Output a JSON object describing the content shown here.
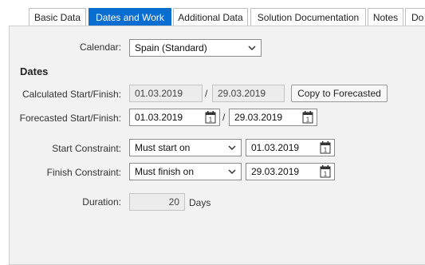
{
  "tabs": [
    {
      "label": "Basic Data",
      "active": false
    },
    {
      "label": "Dates and Work",
      "active": true
    },
    {
      "label": "Additional Data",
      "active": false
    },
    {
      "label": "Solution Documentation",
      "active": false
    },
    {
      "label": "Notes",
      "active": false
    },
    {
      "label": "Do",
      "active": false
    }
  ],
  "calendar": {
    "label": "Calendar:",
    "value": "Spain (Standard)"
  },
  "dates": {
    "heading": "Dates",
    "calculated": {
      "label": "Calculated Start/Finish:",
      "start": "01.03.2019",
      "finish": "29.03.2019",
      "separator": "/"
    },
    "copy_button": "Copy to Forecasted",
    "forecasted": {
      "label": "Forecasted Start/Finish:",
      "start": "01.03.2019",
      "finish": "29.03.2019",
      "separator": "/"
    }
  },
  "start_constraint": {
    "label": "Start Constraint:",
    "value": "Must start on",
    "date": "01.03.2019"
  },
  "finish_constraint": {
    "label": "Finish Constraint:",
    "value": "Must finish on",
    "date": "29.03.2019"
  },
  "duration": {
    "label": "Duration:",
    "value": "20",
    "unit": "Days"
  },
  "colors": {
    "accent": "#0a6ed1",
    "panel_bg": "#f2f2f2"
  },
  "icons": {
    "dropdown": "chevron-down-icon",
    "calendar": "calendar-icon"
  }
}
